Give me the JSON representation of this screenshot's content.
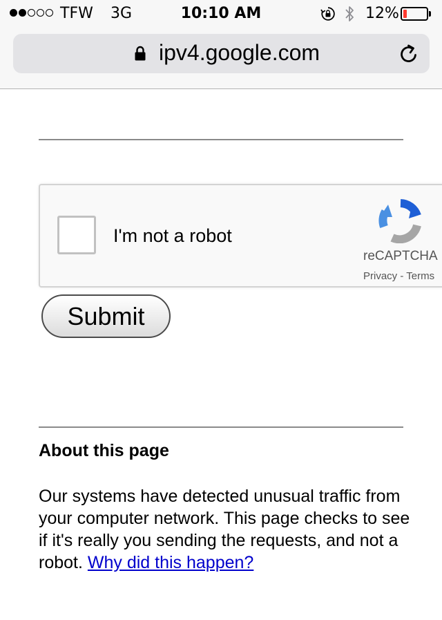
{
  "status_bar": {
    "carrier": "TFW",
    "network": "3G",
    "time": "10:10 AM",
    "battery_percent": "12%",
    "signal_bars_filled": 2,
    "signal_bars_total": 5,
    "battery_level": 0.12,
    "icons": [
      "signal-dots",
      "rotation-lock-icon",
      "bluetooth-icon",
      "battery-icon"
    ]
  },
  "browser": {
    "url": "ipv4.google.com",
    "icons": [
      "lock-icon",
      "reload-icon"
    ]
  },
  "recaptcha": {
    "label": "I'm not a robot",
    "brand": "reCAPTCHA",
    "privacy": "Privacy",
    "separator": " - ",
    "terms": "Terms",
    "checked": false
  },
  "form": {
    "submit_label": "Submit"
  },
  "about": {
    "title": "About this page",
    "body": "Our systems have detected unusual traffic from your computer network. This page checks to see if it's really you sending the requests, and not a robot.",
    "link_text": "Why did this happen?"
  },
  "colors": {
    "link": "#0000cc",
    "battery_low": "#ff3b30",
    "recaptcha_blue": "#4a90e2",
    "recaptcha_gray": "#a6a6a6"
  }
}
